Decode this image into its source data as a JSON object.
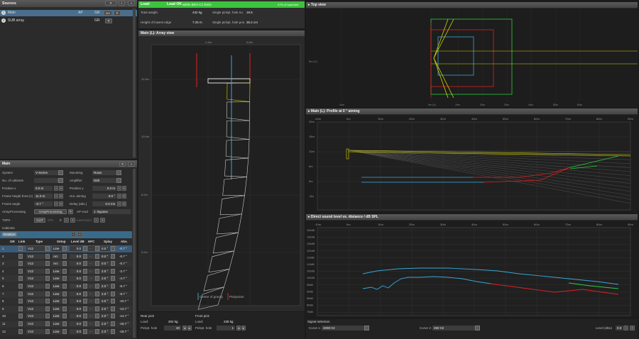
{
  "sources": {
    "title": "Sources",
    "items": [
      {
        "num": "1",
        "name": "Main",
        "ap": "AP",
        "gr": "GR",
        "ms": "MS"
      },
      {
        "num": "2",
        "name": "SUB array",
        "gr": "GR"
      }
    ]
  },
  "main_panel": {
    "title": "Main",
    "fields": [
      {
        "label": "System",
        "value": "V-Series",
        "label2": "Mounting",
        "value2": "Rows"
      },
      {
        "label": "No. of cabinets",
        "value": "12",
        "label2": "Amplifier",
        "value2": "D80"
      },
      {
        "label": "Position x",
        "value": "0.0 m",
        "label2": "Position y",
        "value2": "0.0 m"
      },
      {
        "label": "Frame height front (z)",
        "value": "11.0 m",
        "label2": "Hor. aiming",
        "value2": "0.0 °"
      },
      {
        "label": "Frame angle",
        "value": "-0.7 °",
        "label2": "Delay (abs.)",
        "value2": "0.0 ms"
      }
    ],
    "array_processing_label": "ArrayProcessing",
    "array_processing_btn": "ArrayProcessing",
    "ap_mode_label": "AP mod",
    "ap_mode_value": "1: Bypass",
    "tops_label": "TOPs",
    "cut": "CUT",
    "cpl": "CPL",
    "cpl_val": "0",
    "level_label": "Level (rel.)",
    "cabinets_label": "Cabinets",
    "relative_btn": "Relative",
    "table_headers": [
      "GR",
      "Link",
      "Type",
      "Setup",
      "Level dB",
      "HFC",
      "Splay",
      "Abs."
    ],
    "rows": [
      {
        "n": "1",
        "type": "V12",
        "setup": "Line",
        "level": "0.0",
        "hfc": "--",
        "splay": "0.0 °",
        "abs": "-0.7 °"
      },
      {
        "n": "2",
        "type": "V12",
        "setup": "Arc",
        "level": "0.0",
        "hfc": "--",
        "splay": "0.0 °",
        "abs": "-0.7 °"
      },
      {
        "n": "3",
        "type": "V12",
        "setup": "Arc",
        "level": "0.0",
        "hfc": "--",
        "splay": "0.0 °",
        "abs": "-0.7 °"
      },
      {
        "n": "4",
        "type": "V12",
        "setup": "Line",
        "level": "0.0",
        "hfc": "--",
        "splay": "2.0 °",
        "abs": "-2.7 °"
      },
      {
        "n": "5",
        "type": "V12",
        "setup": "Line",
        "level": "0.0",
        "hfc": "--",
        "splay": "2.0 °",
        "abs": "-4.7 °"
      },
      {
        "n": "6",
        "type": "V12",
        "setup": "Line",
        "level": "0.0",
        "hfc": "--",
        "splay": "2.0 °",
        "abs": "-6.7 °"
      },
      {
        "n": "7",
        "type": "V12",
        "setup": "Line",
        "level": "0.0",
        "hfc": "--",
        "splay": "2.0 °",
        "abs": "-8.7 °"
      },
      {
        "n": "8",
        "type": "V12",
        "setup": "Line",
        "level": "0.0",
        "hfc": "--",
        "splay": "2.0 °",
        "abs": "-10.7 °"
      },
      {
        "n": "9",
        "type": "V12",
        "setup": "Line",
        "level": "0.0",
        "hfc": "--",
        "splay": "2.0 °",
        "abs": "-12.7 °"
      },
      {
        "n": "10",
        "type": "V12",
        "setup": "Line",
        "level": "0.0",
        "hfc": "--",
        "splay": "2.0 °",
        "abs": "-14.7 °"
      },
      {
        "n": "11",
        "type": "V12",
        "setup": "Line",
        "level": "0.0",
        "hfc": "--",
        "splay": "2.0 °",
        "abs": "-16.7 °"
      },
      {
        "n": "12",
        "type": "V12",
        "setup": "Line",
        "level": "0.0",
        "hfc": "--",
        "splay": "2.0 °",
        "abs": "-18.7 °"
      }
    ]
  },
  "load": {
    "label": "Load:",
    "status": "Load OK",
    "limit": "within BGV-C1 limits",
    "percent": "47% of load limit",
    "total_weight_label": "Total weight",
    "total_weight": "432 kg",
    "hole_label": "Single pickpt. hole no.",
    "hole": "19.5",
    "lowest_label": "Height of lowest edge",
    "lowest": "7.25 m",
    "hole_pos_label": "Single pickpt. hole pos.",
    "hole_pos": "35.2 cm"
  },
  "array_view": {
    "title": "Main (L): Array view",
    "xticks": [
      "-1.0m",
      "0.0m"
    ],
    "yticks": [
      "11.0m",
      "10.0m",
      "6.0m",
      "0.0m"
    ],
    "legend_cog": "Center of gravity",
    "legend_pick": "Pickpoints"
  },
  "picks": {
    "rear": "Rear pick",
    "front": "Front pick",
    "rear_load_label": "Load:",
    "rear_load": "204 kg",
    "front_load_label": "Load:",
    "front_load": "228 kg",
    "rear_hole_label": "Pickpt. hole",
    "rear_hole": "40",
    "front_hole_label": "Pickpt. hole",
    "front_hole": "1"
  },
  "top_view": {
    "title": "Top view",
    "yl": "0m (Y)",
    "xticks": [
      "-10m",
      "0m (X)",
      "10m",
      "20m",
      "30m",
      "40m",
      "50m",
      "60m"
    ]
  },
  "profile": {
    "title": "Main (L): Profile at 0 ° aiming",
    "xticks": [
      "-10m",
      "0m",
      "10m",
      "20m",
      "30m",
      "40m",
      "50m",
      "60m",
      "70m",
      "80m",
      "90m"
    ],
    "yticks": [
      "20m",
      "15m",
      "10m",
      "5m",
      "0m",
      "-5m"
    ]
  },
  "spl": {
    "title": "Direct sound level vs. distance / dB SPL",
    "xticks": [
      "-10m",
      "0m",
      "10m",
      "20m",
      "30m",
      "40m",
      "50m",
      "60m",
      "70m",
      "80m",
      "90m"
    ],
    "yticks": [
      "140dB",
      "130dB",
      "125dB",
      "120dB",
      "115dB",
      "110dB",
      "105dB",
      "100dB",
      "95dB",
      "90dB",
      "85dB",
      "80dB",
      "75dB"
    ]
  },
  "signal": {
    "title": "Signal selection",
    "curve1_label": "Curve 1:",
    "curve1": "4000 Hz",
    "curve2_label": "Curve 2:",
    "curve2": "250 Hz",
    "level_label": "Level (dBu)",
    "level": "0.0"
  }
}
